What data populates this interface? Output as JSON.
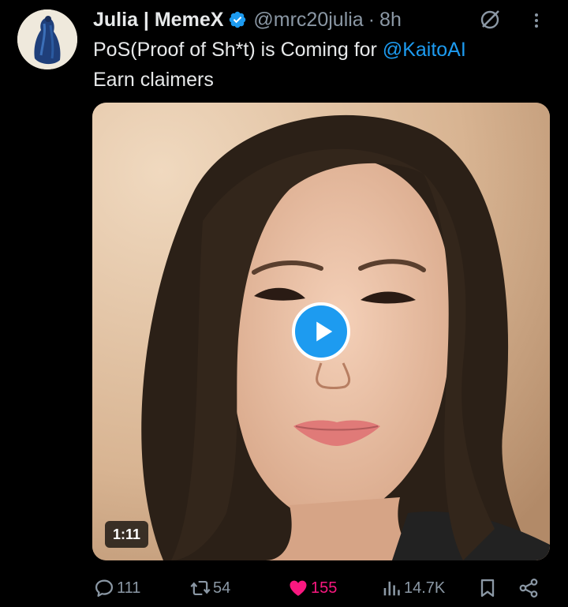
{
  "author": {
    "display_name": "Julia | MemeX",
    "handle": "@mrc20julia",
    "separator": "·",
    "time_ago": "8h"
  },
  "tweet": {
    "text_part1": "PoS(Proof of Sh*t) is Coming for ",
    "mention": "@KaitoAI",
    "text_line2": "Earn claimers"
  },
  "video": {
    "duration": "1:11"
  },
  "actions": {
    "replies": "111",
    "reposts": "54",
    "likes": "155",
    "views": "14.7K"
  },
  "colors": {
    "background": "#000000",
    "accent": "#1d9bf0",
    "like": "#f91880",
    "secondary_text": "#8b98a5"
  }
}
